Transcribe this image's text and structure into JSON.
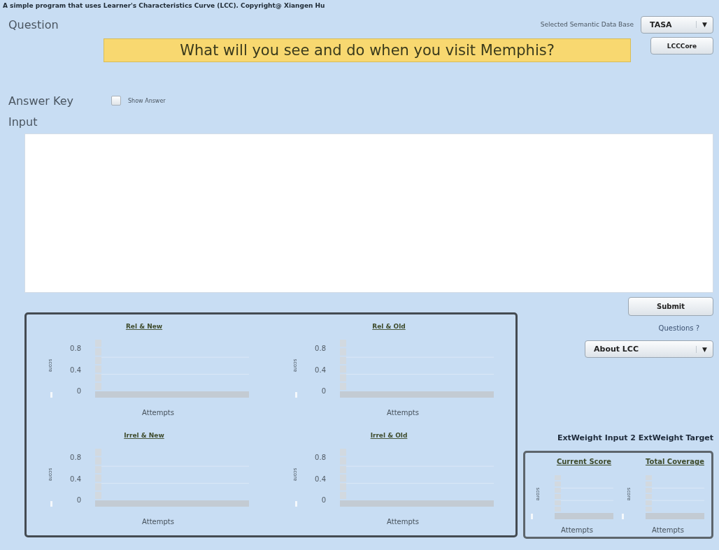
{
  "header": {
    "caption": "A simple program that uses Learner's Characteristics Curve (LCC). Copyright@ Xiangen Hu"
  },
  "question": {
    "label": "Question",
    "text": "What will you see and do when you visit Memphis?"
  },
  "database": {
    "label": "Selected Semantic Data Base",
    "value": "TASA",
    "arrow": "▼"
  },
  "core_button": "LCCCore",
  "answer_key": {
    "label": "Answer Key",
    "checkbox_label": "Show Answer",
    "checked": false
  },
  "input": {
    "label": "Input"
  },
  "submit_button": "Submit",
  "questions_label": "Questions ?",
  "about": {
    "value": "About LCC",
    "arrow": "▼"
  },
  "ext_weight": "ExtWeight Input 2 ExtWeight Target",
  "charts": [
    {
      "title": "Rel & New",
      "ylabel": "score",
      "xlabel": "Attempts",
      "yticks": [
        "0.8",
        "0.4",
        "0"
      ]
    },
    {
      "title": "Rel & Old",
      "ylabel": "score",
      "xlabel": "Attempts",
      "yticks": [
        "0.8",
        "0.4",
        "0"
      ]
    },
    {
      "title": "Irrel & New",
      "ylabel": "score",
      "xlabel": "Attempts",
      "yticks": [
        "0.8",
        "0.4",
        "0"
      ]
    },
    {
      "title": "Irrel & Old",
      "ylabel": "score",
      "xlabel": "Attempts",
      "yticks": [
        "0.8",
        "0.4",
        "0"
      ]
    }
  ],
  "small_charts": [
    {
      "title": "Current Score",
      "ylabel": "score",
      "xlabel": "Attempts"
    },
    {
      "title": "Total Coverage",
      "ylabel": "score",
      "xlabel": "Attempts"
    }
  ]
}
